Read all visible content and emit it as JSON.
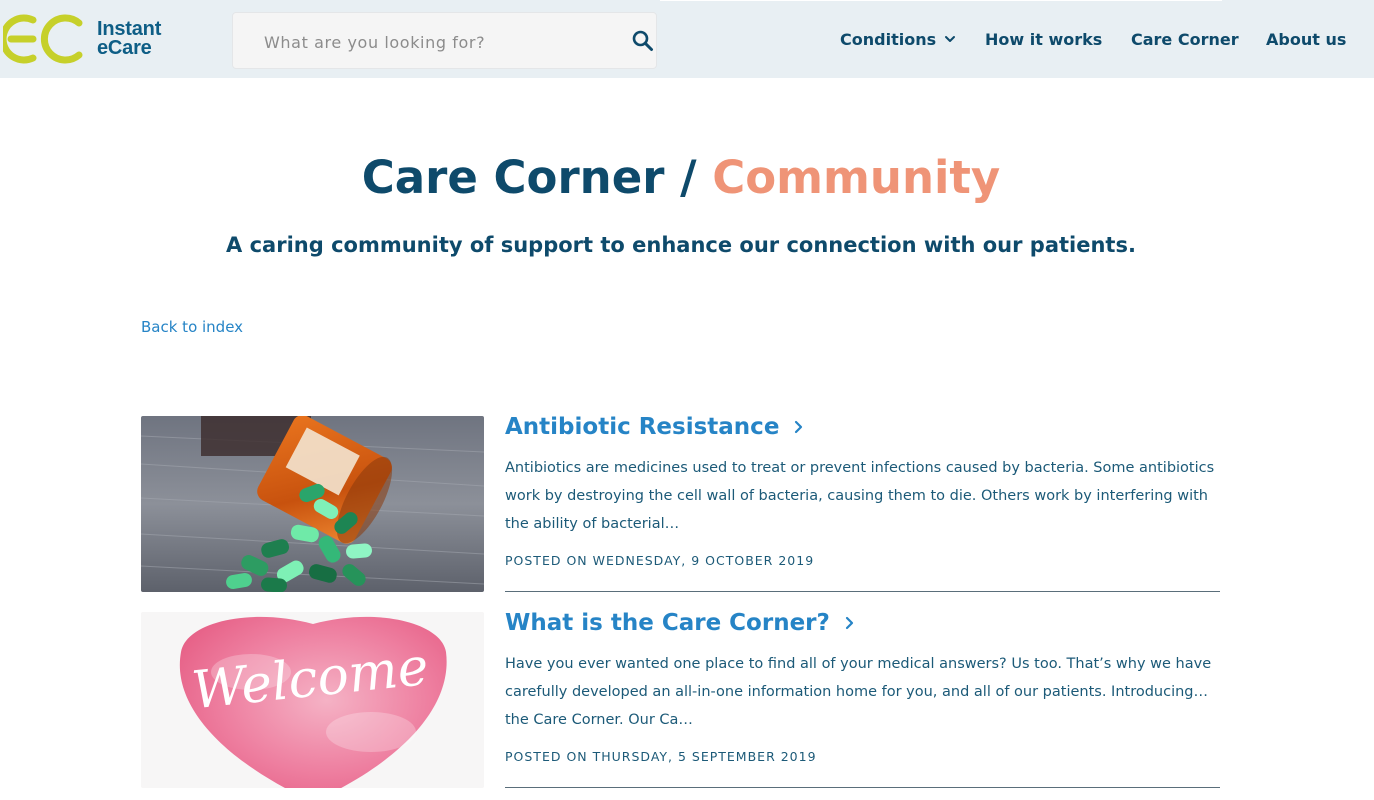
{
  "brand": {
    "logo_line1": "Instant",
    "logo_line2": "eCare",
    "colors": {
      "navy": "#0e4a6b",
      "blue": "#2684c6",
      "coral": "#ef9477",
      "lime": "#c6d02a",
      "header_bg": "#e8eff3"
    }
  },
  "header": {
    "search_placeholder": "What are you looking for?",
    "search_icon": "search-icon",
    "nav": [
      {
        "label": "Conditions",
        "icon": "chevron-down-icon"
      },
      {
        "label": "How it works"
      },
      {
        "label": "Care Corner"
      },
      {
        "label": "About us"
      }
    ]
  },
  "page": {
    "title_main": "Care Corner",
    "title_separator": " / ",
    "title_accent": "Community",
    "subtitle": "A caring community of support to enhance our connection with our patients.",
    "back_link": "Back to index"
  },
  "posts": [
    {
      "title": "Antibiotic Resistance",
      "excerpt": "Antibiotics are medicines used to treat or prevent infections caused by bacteria. Some antibiotics work by destroying the cell wall of bacteria, causing them to die. Others work by interfering with the ability of bacterial…",
      "date": "POSTED ON WEDNESDAY, 9 OCTOBER 2019",
      "image": "spilled-pill-bottle-image"
    },
    {
      "title": "What is the Care Corner?",
      "excerpt": "Have you ever wanted one place to find all of your medical answers? Us too. That’s why we have carefully developed an all-in-one information home for you, and all of our patients. Introducing… the Care Corner. Our Ca…",
      "date": "POSTED ON THURSDAY, 5 SEPTEMBER 2019",
      "image": "welcome-heart-image",
      "image_text": "Welcome"
    }
  ]
}
